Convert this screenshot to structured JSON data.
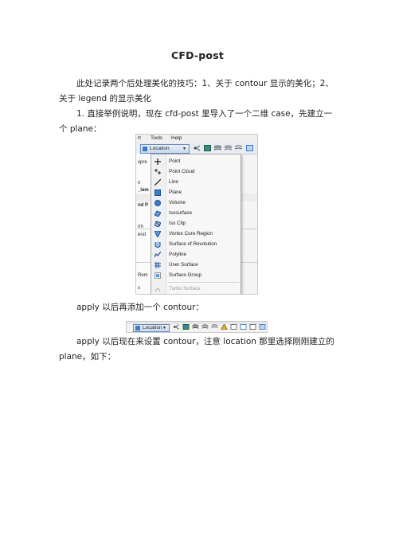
{
  "document": {
    "title": "CFD-post",
    "para1": "此处记录两个后处理美化的技巧：1、关于 contour 显示的美化；2、关于 legend 的显示美化",
    "para2": "1. 直接举例说明，现在 cfd-post 里导入了一个二维 case，先建立一个 plane：",
    "para3": "apply 以后再添加一个 contour：",
    "para4": "apply 以后现在来设置 contour，注意 location 那里选择刚刚建立的 plane，如下："
  },
  "screenshot1": {
    "menubar": [
      "rt",
      "Tools",
      "Help"
    ],
    "location_button": "Location",
    "left_panel": [
      "xpre",
      "n",
      "_lam",
      "nd P",
      "rm",
      "end",
      "Rem",
      "s"
    ],
    "menu_items": [
      {
        "label": "Point",
        "icon": "point-icon"
      },
      {
        "label": "Point Cloud",
        "icon": "point-cloud-icon"
      },
      {
        "label": "Line",
        "icon": "line-icon"
      },
      {
        "label": "Plane",
        "icon": "plane-icon"
      },
      {
        "label": "Volume",
        "icon": "volume-icon"
      },
      {
        "label": "Isosurface",
        "icon": "isosurface-icon"
      },
      {
        "label": "Iso Clip",
        "icon": "iso-clip-icon"
      },
      {
        "label": "Vortex Core Region",
        "icon": "vortex-core-icon"
      },
      {
        "label": "Surface of Revolution",
        "icon": "surface-revolution-icon"
      },
      {
        "label": "Polyline",
        "icon": "polyline-icon"
      },
      {
        "label": "User Surface",
        "icon": "user-surface-icon"
      },
      {
        "label": "Surface Group",
        "icon": "surface-group-icon"
      },
      {
        "label": "Turbo Surface",
        "icon": "turbo-surface-icon",
        "disabled": true
      }
    ]
  },
  "screenshot2": {
    "location_button": "Location"
  },
  "colors": {
    "menu_bg": "#f7f7f7",
    "button_border": "#6b88b8",
    "icon_blue": "#3f7bc9"
  }
}
